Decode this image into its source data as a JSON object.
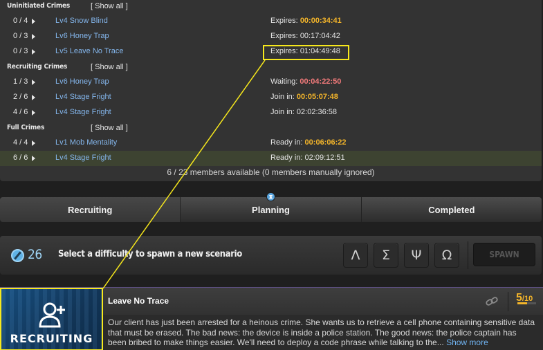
{
  "uninitiated": {
    "title": "Uninitiated Crimes",
    "show_all": "[ Show all ]",
    "rows": [
      {
        "count": "0 / 4",
        "name": "Lv4 Snow Blind",
        "status": "Expires:",
        "time": "00:00:34:41",
        "time_color": "orange"
      },
      {
        "count": "0 / 3",
        "name": "Lv6 Honey Trap",
        "status": "Expires:",
        "time": "00:17:04:42",
        "time_color": "plain"
      },
      {
        "count": "0 / 3",
        "name": "Lv5 Leave No Trace",
        "status": "Expires:",
        "time": "01:04:49:48",
        "time_color": "plain"
      }
    ]
  },
  "recruiting": {
    "title": "Recruiting Crimes",
    "show_all": "[ Show all ]",
    "rows": [
      {
        "count": "1 / 3",
        "name": "Lv6 Honey Trap",
        "status": "Waiting:",
        "time": "00:04:22:50",
        "time_color": "red"
      },
      {
        "count": "2 / 6",
        "name": "Lv4 Stage Fright",
        "status": "Join in:",
        "time": "00:05:07:48",
        "time_color": "orange"
      },
      {
        "count": "4 / 6",
        "name": "Lv4 Stage Fright",
        "status": "Join in:",
        "time": "02:02:36:58",
        "time_color": "plain"
      }
    ]
  },
  "full": {
    "title": "Full Crimes",
    "show_all": "[ Show all ]",
    "rows": [
      {
        "count": "4 / 4",
        "name": "Lv1 Mob Mentality",
        "status": "Ready in:",
        "time": "00:06:06:22",
        "time_color": "orange"
      },
      {
        "count": "6 / 6",
        "name": "Lv4 Stage Fright",
        "status": "Ready in:",
        "time": "02:09:12:51",
        "time_color": "plain",
        "highlighted": true
      }
    ]
  },
  "members_line": "6 / 23 members available (0 members manually ignored)",
  "tabs": [
    {
      "label": "Recruiting",
      "active": true
    },
    {
      "label": "Planning",
      "active": false,
      "icon": "hourglass-icon"
    },
    {
      "label": "Completed",
      "active": false
    }
  ],
  "planning_icon_glyph": "⧗",
  "spawn": {
    "scope_count": "26",
    "prompt": "Select a difficulty to spawn a new scenario",
    "difficulties": [
      {
        "glyph": "Λ",
        "name": "lambda"
      },
      {
        "glyph": "Σ",
        "name": "sigma"
      },
      {
        "glyph": "Ψ",
        "name": "psi"
      },
      {
        "glyph": "Ω",
        "name": "omega"
      }
    ],
    "button": "SPAWN"
  },
  "scenario": {
    "badge": "RECRUITING",
    "title": "Leave No Trace",
    "slots_filled": "5",
    "slots_total": "/10",
    "slots_fraction": 0.5,
    "description": "Our client has just been arrested for a heinous crime. She wants us to retrieve a cell phone containing sensitive data that must be erased. The bad news: the device is inside a police station. The good news: the police captain has been bribed to make things easier. We'll need to deploy a code phrase while talking to the...",
    "show_more": "Show more"
  },
  "colors": {
    "highlight": "#f7e81c",
    "orange": "#f4b52a",
    "red": "#f27a7a",
    "link": "#84b6ec"
  }
}
